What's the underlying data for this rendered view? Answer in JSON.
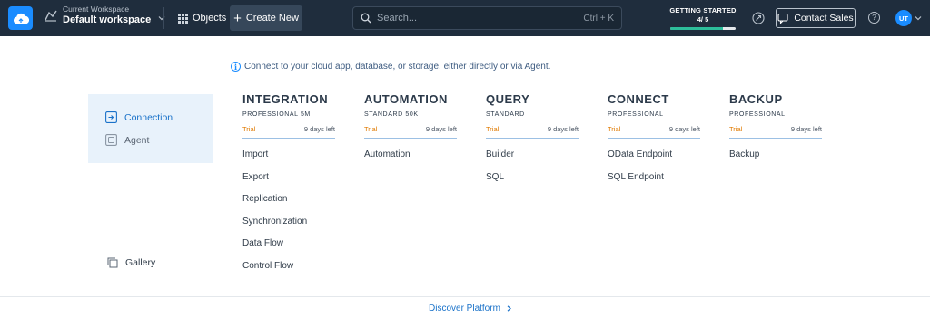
{
  "topbar": {
    "workspace_label": "Current Workspace",
    "workspace_name": "Default workspace",
    "objects_label": "Objects",
    "create_label": "Create New",
    "search_placeholder": "Search...",
    "search_shortcut": "Ctrl + K",
    "getting_started_title": "GETTING STARTED",
    "getting_started_count": "4/ 5",
    "getting_started_progress": 0.8,
    "contact_label": "Contact Sales",
    "help_label": "?",
    "avatar_initials": "UT"
  },
  "info": {
    "icon_text": "i",
    "message": "Connect to your cloud app, database, or storage, either directly or via Agent."
  },
  "sidebar": {
    "items": [
      {
        "label": "Connection",
        "icon": "connection-icon",
        "active": true
      },
      {
        "label": "Agent",
        "icon": "agent-icon",
        "active": false
      }
    ],
    "gallery_label": "Gallery"
  },
  "products": [
    {
      "title": "INTEGRATION",
      "plan": "PROFESSIONAL 5M",
      "status": "Trial",
      "remaining": "9 days left",
      "items": [
        "Import",
        "Export",
        "Replication",
        "Synchronization",
        "Data Flow",
        "Control Flow"
      ]
    },
    {
      "title": "AUTOMATION",
      "plan": "STANDARD 50K",
      "status": "Trial",
      "remaining": "9 days left",
      "items": [
        "Automation"
      ]
    },
    {
      "title": "QUERY",
      "plan": "STANDARD",
      "status": "Trial",
      "remaining": "9 days left",
      "items": [
        "Builder",
        "SQL"
      ]
    },
    {
      "title": "CONNECT",
      "plan": "PROFESSIONAL",
      "status": "Trial",
      "remaining": "9 days left",
      "items": [
        "OData Endpoint",
        "SQL Endpoint"
      ]
    },
    {
      "title": "BACKUP",
      "plan": "PROFESSIONAL",
      "status": "Trial",
      "remaining": "9 days left",
      "items": [
        "Backup"
      ]
    }
  ],
  "footer": {
    "discover_label": "Discover Platform"
  },
  "colors": {
    "topbar_bg": "#1f2d3d",
    "accent": "#1a8cff",
    "trial": "#e07a00",
    "progress": "#2dbe9b"
  }
}
